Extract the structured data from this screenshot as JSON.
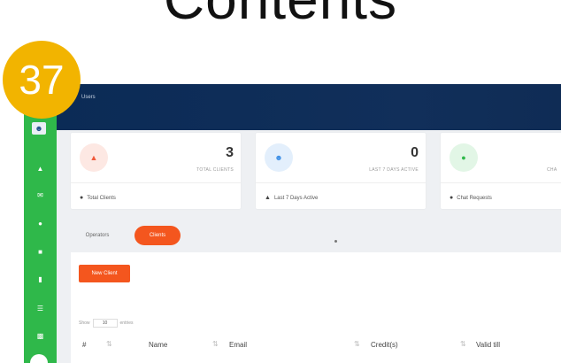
{
  "heading": "Contents",
  "badge": "37",
  "topbar": {
    "breadcrumb": "Users"
  },
  "sidebar": {
    "icons": [
      "dashboard-icon",
      "mail-icon",
      "chat-icon",
      "users-icon",
      "document-icon",
      "list-icon",
      "chart-icon"
    ]
  },
  "cards": [
    {
      "value": "3",
      "label": "TOTAL CLIENTS",
      "footer": "Total Clients",
      "color": "#f05a3c"
    },
    {
      "value": "0",
      "label": "LAST 7 DAYS ACTIVE",
      "footer": "Last 7 Days Active",
      "color": "#3b8ee6"
    },
    {
      "value": "",
      "label": "CHA",
      "footer": "Chat Requests",
      "color": "#2fb84a"
    }
  ],
  "tabs": {
    "operators": "Operators",
    "clients": "Clients"
  },
  "panel": {
    "new_button": "New Client",
    "show_label": "Show",
    "show_value": "10",
    "entries_label": "entries",
    "columns": [
      "#",
      "Name",
      "Email",
      "Credit(s)",
      "Valid till"
    ]
  },
  "colors": {
    "accent": "#f4561e",
    "sidebar": "#2fb84a",
    "topbar": "#0b2b56",
    "badge": "#f2b400"
  }
}
